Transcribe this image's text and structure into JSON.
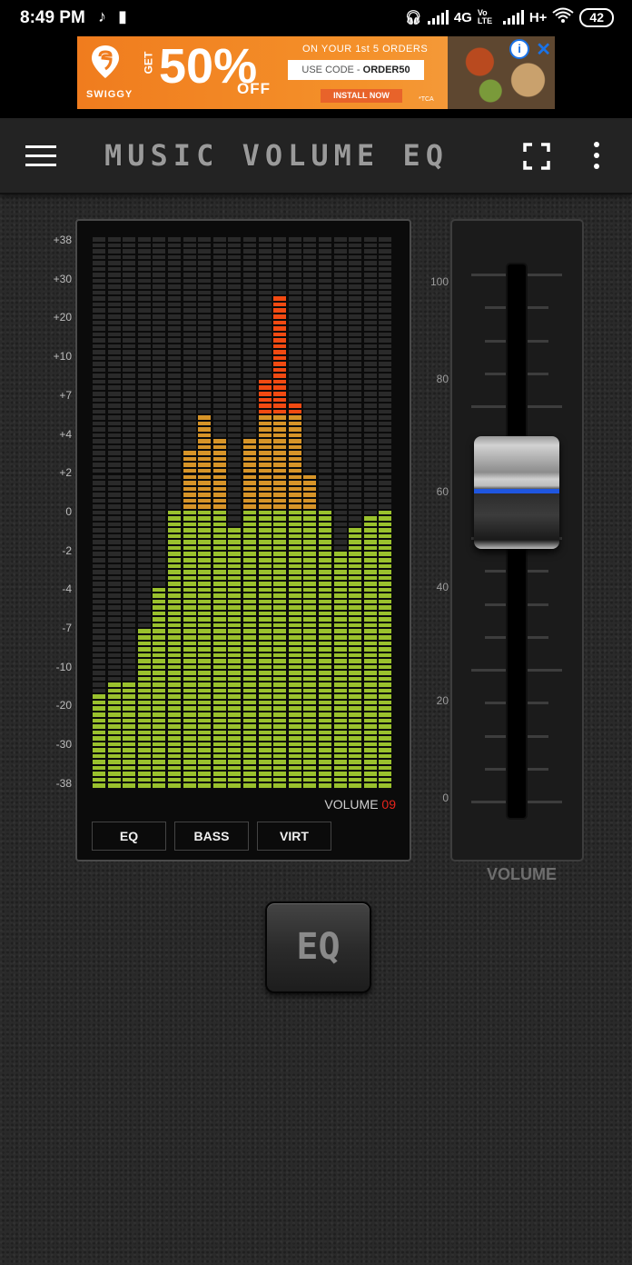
{
  "status_bar": {
    "time": "8:49 PM",
    "network": "4G",
    "volte": "Vo LTE",
    "hplus": "H+",
    "battery": "42"
  },
  "ad": {
    "brand": "SWIGGY",
    "get": "GET",
    "percent": "50%",
    "off": "OFF",
    "line1": "ON YOUR 1st 5 ORDERS",
    "code_label": "USE CODE -",
    "code": "ORDER50",
    "install": "INSTALL NOW",
    "tca": "*TCA"
  },
  "toolbar": {
    "title": "MUSIC VOLUME EQ"
  },
  "eq_panel": {
    "db_labels": [
      "+38",
      "+30",
      "+20",
      "+10",
      "+7",
      "+4",
      "+2",
      "0",
      "-2",
      "-4",
      "-7",
      "-10",
      "-20",
      "-30",
      "-38"
    ],
    "volume_label": "VOLUME",
    "volume_value": "09",
    "buttons": [
      "EQ",
      "BASS",
      "VIRT"
    ],
    "colors": {
      "low": "#9ac12d",
      "mid": "#d79428",
      "high": "#f24a12",
      "off": "#2a2a2a"
    }
  },
  "eq_bars": {
    "total_segments": 93,
    "lit_segments": [
      16,
      18,
      18,
      27,
      34,
      47,
      57,
      63,
      59,
      44,
      59,
      69,
      83,
      65,
      53,
      47,
      40,
      44,
      46,
      47
    ]
  },
  "volume_slider": {
    "scale_labels": [
      "100",
      "80",
      "60",
      "40",
      "20",
      "0"
    ],
    "level_percent": 60,
    "title": "VOLUME"
  },
  "eq_toggle": {
    "label": "EQ"
  }
}
